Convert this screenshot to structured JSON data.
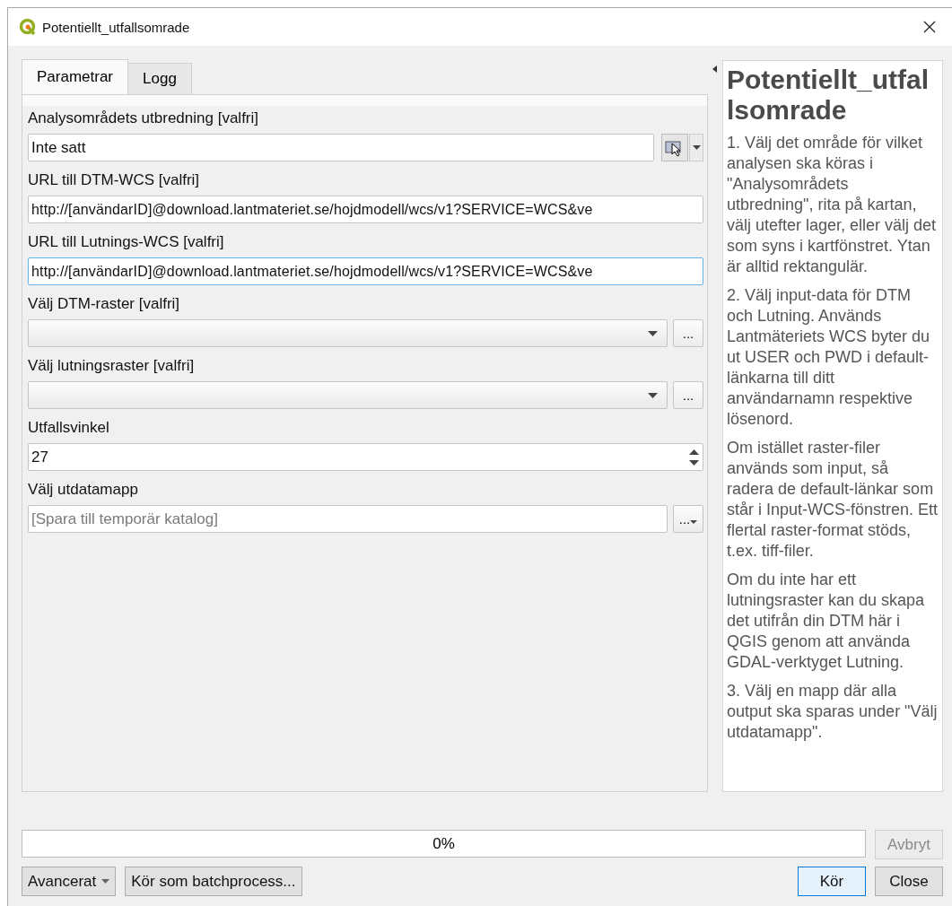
{
  "window": {
    "title": "Potentiellt_utfallsomrade"
  },
  "tabs": [
    {
      "label": "Parametrar",
      "selected": true
    },
    {
      "label": "Logg",
      "selected": false
    }
  ],
  "parameters": [
    {
      "kind": "extent",
      "label": "Analysområdets utbredning [valfri]",
      "value": "Inte satt"
    },
    {
      "kind": "text",
      "label": "URL till DTM-WCS [valfri]",
      "value": "http://[användarID]@download.lantmateriet.se/hojdmodell/wcs/v1?SERVICE=WCS&ve",
      "focused": false
    },
    {
      "kind": "text",
      "label": "URL till Lutnings-WCS [valfri]",
      "value": "http://[användarID]@download.lantmateriet.se/hojdmodell/wcs/v1?SERVICE=WCS&ve",
      "focused": true
    },
    {
      "kind": "combo",
      "label": "Välj DTM-raster [valfri]",
      "button": "..."
    },
    {
      "kind": "combo",
      "label": "Välj lutningsraster [valfri]",
      "button": "..."
    },
    {
      "kind": "spin",
      "label": "Utfallsvinkel",
      "value": "27"
    },
    {
      "kind": "folder",
      "label": "Välj utdatamapp",
      "placeholder": "[Spara till temporär katalog]",
      "button": "..."
    }
  ],
  "help": {
    "title": "Potentiellt_utfallsomrade",
    "paragraphs": [
      "1. Välj det område för vilket analysen ska köras i \"Analysområdets utbredning\", rita på kartan, välj utefter lager, eller välj det som syns i kartfönstret. Ytan är alltid rektangulär.",
      "2. Välj input-data för DTM och Lutning. Används Lantmäteriets WCS byter du ut USER och PWD i default-länkarna till ditt användarnamn respektive lösenord.",
      "Om istället raster-filer används som input, så radera de default-länkar som står i Input-WCS-fönstren. Ett flertal raster-format stöds, t.ex. tiff-filer.",
      "Om du inte har ett lutningsraster kan du skapa det utifrån din DTM här i QGIS genom att använda GDAL-verktyget Lutning.",
      "3. Välj en mapp där alla output ska sparas under \"Välj utdatamapp\"."
    ]
  },
  "progress": {
    "text": "0%"
  },
  "cancel_button": {
    "label": "Avbryt",
    "disabled": true
  },
  "buttons": [
    {
      "kind": "menu",
      "label": "Avancerat",
      "default": false
    },
    {
      "kind": "plain",
      "label": "Kör som batchprocess...",
      "default": false
    },
    {
      "kind": "spacer"
    },
    {
      "kind": "plain",
      "label": "Kör",
      "default": true
    },
    {
      "kind": "plain",
      "label": "Close",
      "default": false
    }
  ]
}
